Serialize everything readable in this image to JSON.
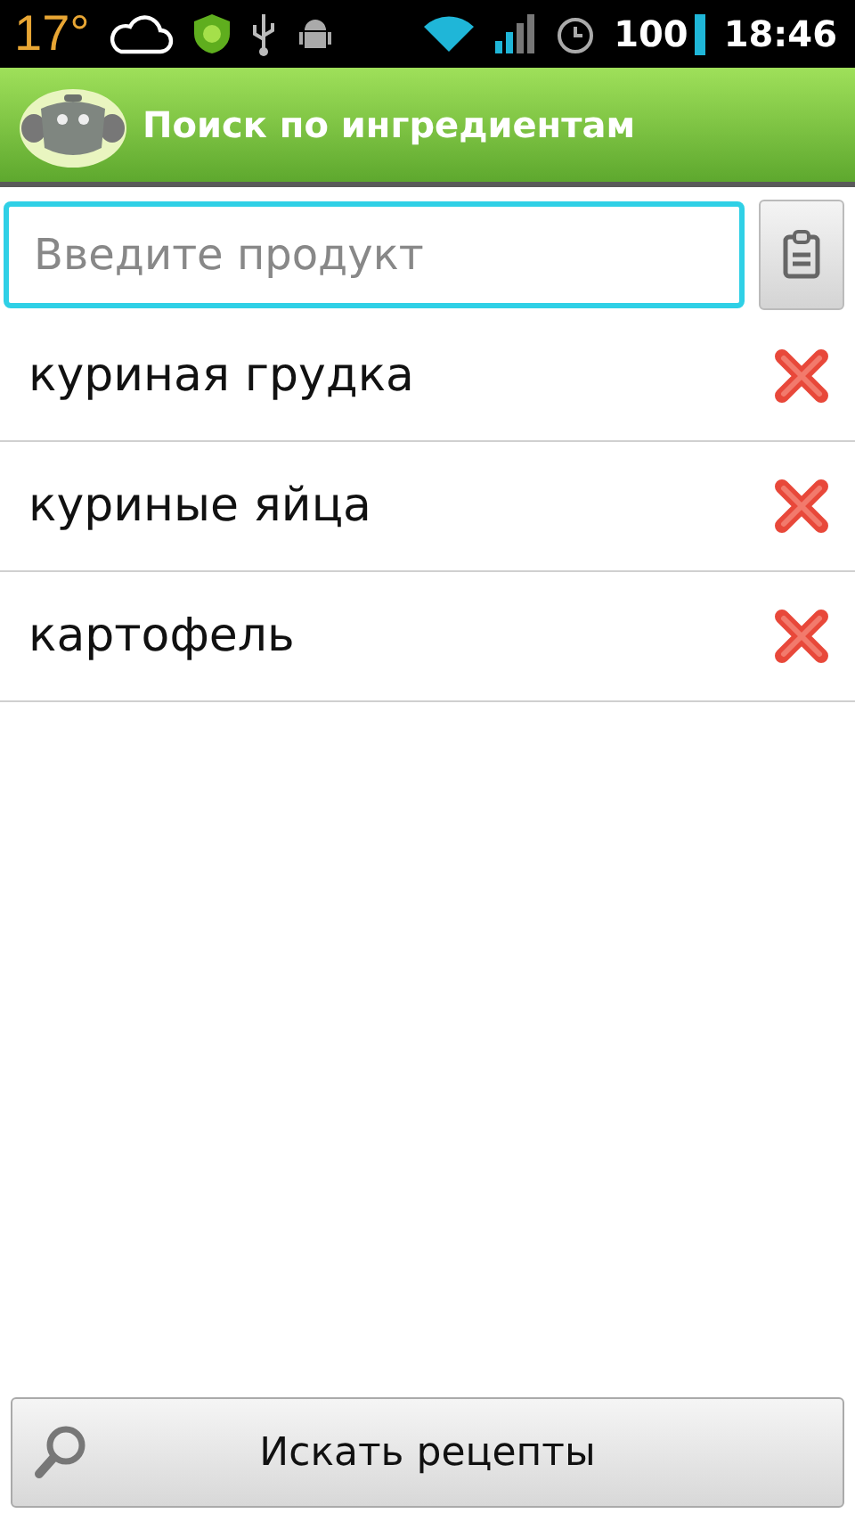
{
  "status_bar": {
    "temperature": "17°",
    "battery": "100",
    "time": "18:46"
  },
  "app_bar": {
    "title": "Поиск по ингредиентам"
  },
  "search": {
    "placeholder": "Введите продукт"
  },
  "ingredients": [
    {
      "name": "куриная грудка"
    },
    {
      "name": "куриные яйца"
    },
    {
      "name": "картофель"
    }
  ],
  "search_button": {
    "label": "Искать рецепты"
  }
}
